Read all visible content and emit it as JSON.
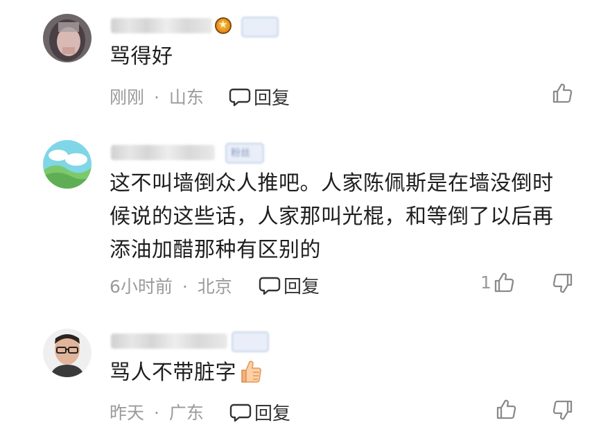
{
  "comments": [
    {
      "text": "骂得好",
      "time": "刚刚",
      "location": "山东",
      "reply_label": "回复",
      "likes": ""
    },
    {
      "badge": "粉丝",
      "text": "这不叫墙倒众人推吧。人家陈佩斯是在墙没倒时候说的这些话，人家那叫光棍，和等倒了以后再添油加醋那种有区别的",
      "time": "6小时前",
      "location": "北京",
      "reply_label": "回复",
      "likes": "1"
    },
    {
      "text": "骂人不带脏字",
      "emoji": "thumbs-up-emoji",
      "time": "昨天",
      "location": "广东",
      "reply_label": "回复",
      "likes": ""
    }
  ],
  "separator": "·",
  "colors": {
    "meta": "#9a9a9a",
    "text": "#1e1e1e"
  }
}
